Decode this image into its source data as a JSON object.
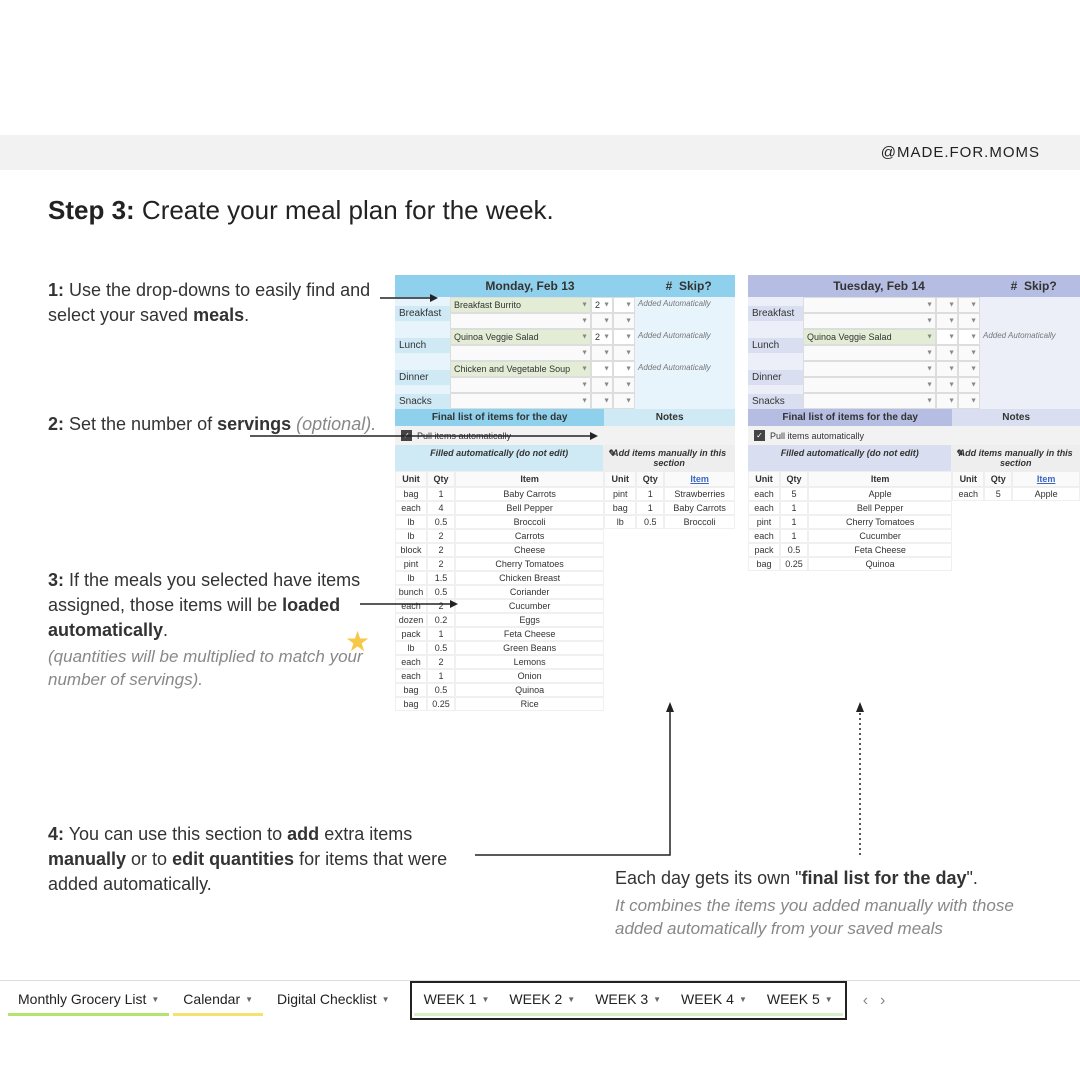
{
  "brand": "@MADE.FOR.MOMS",
  "heading_bold": "Step 3:",
  "heading_rest": " Create your meal plan for the week.",
  "ins1_n": "1:",
  "ins1": " Use the drop-downs to easily find and select your saved ",
  "ins1_b": "meals",
  "ins1_end": ".",
  "ins2_n": "2:",
  "ins2": " Set the number of ",
  "ins2_b": "servings",
  "ins2_it": " (optional).",
  "ins3_n": "3:",
  "ins3": " If the meals you selected have items assigned, those items will be ",
  "ins3_b": "loaded automatically",
  "ins3_end": ".",
  "ins3_sub": "(quantities will be multiplied to match your number of servings).",
  "ins4_n": "4:",
  "ins4_a": " You can use this section to ",
  "ins4_b1": "add",
  "ins4_b": " extra items ",
  "ins4_b2": "manually",
  "ins4_c": " or to ",
  "ins4_b3": "edit quantities",
  "ins4_d": " for items that were added automatically.",
  "insday_a": "Each day gets its own \"",
  "insday_b": "final list for the day",
  "insday_c": "\".",
  "insday_sub": "It combines the items you added manually with those added automatically from your saved meals",
  "hash": "#",
  "skip": "Skip?",
  "added_auto": "Added Automatically",
  "final_label": "Final list of items for the day",
  "notes_label": "Notes",
  "pull_label": "Pull items automatically",
  "sub_auto": "Filled automatically (do not edit)",
  "sub_manual": "Add items manually in this section",
  "col_unit": "Unit",
  "col_qty": "Qty",
  "col_item": "Item",
  "pencil": "✎",
  "meal_labels": {
    "bf": "Breakfast",
    "lu": "Lunch",
    "di": "Dinner",
    "sn": "Snacks"
  },
  "mon": {
    "title": "Monday, Feb 13",
    "bf": "Breakfast Burrito",
    "bf_q": "2",
    "lu": "Quinoa Veggie Salad",
    "lu_q": "2",
    "di": "Chicken and Vegetable Soup",
    "auto_items": [
      {
        "u": "bag",
        "q": "1",
        "i": "Baby Carrots"
      },
      {
        "u": "each",
        "q": "4",
        "i": "Bell Pepper"
      },
      {
        "u": "lb",
        "q": "0.5",
        "i": "Broccoli"
      },
      {
        "u": "lb",
        "q": "2",
        "i": "Carrots"
      },
      {
        "u": "block",
        "q": "2",
        "i": "Cheese"
      },
      {
        "u": "pint",
        "q": "2",
        "i": "Cherry Tomatoes"
      },
      {
        "u": "lb",
        "q": "1.5",
        "i": "Chicken Breast"
      },
      {
        "u": "bunch",
        "q": "0.5",
        "i": "Coriander"
      },
      {
        "u": "each",
        "q": "2",
        "i": "Cucumber"
      },
      {
        "u": "dozen",
        "q": "0.2",
        "i": "Eggs"
      },
      {
        "u": "pack",
        "q": "1",
        "i": "Feta Cheese"
      },
      {
        "u": "lb",
        "q": "0.5",
        "i": "Green Beans"
      },
      {
        "u": "each",
        "q": "2",
        "i": "Lemons"
      },
      {
        "u": "each",
        "q": "1",
        "i": "Onion"
      },
      {
        "u": "bag",
        "q": "0.5",
        "i": "Quinoa"
      },
      {
        "u": "bag",
        "q": "0.25",
        "i": "Rice"
      }
    ],
    "manual_items": [
      {
        "u": "pint",
        "q": "1",
        "i": "Strawberries"
      },
      {
        "u": "bag",
        "q": "1",
        "i": "Baby Carrots"
      },
      {
        "u": "lb",
        "q": "0.5",
        "i": "Broccoli"
      }
    ]
  },
  "tue": {
    "title": "Tuesday, Feb 14",
    "lu": "Quinoa Veggie Salad",
    "auto_items": [
      {
        "u": "each",
        "q": "5",
        "i": "Apple"
      },
      {
        "u": "each",
        "q": "1",
        "i": "Bell Pepper"
      },
      {
        "u": "pint",
        "q": "1",
        "i": "Cherry Tomatoes"
      },
      {
        "u": "each",
        "q": "1",
        "i": "Cucumber"
      },
      {
        "u": "pack",
        "q": "0.5",
        "i": "Feta Cheese"
      },
      {
        "u": "bag",
        "q": "0.25",
        "i": "Quinoa"
      }
    ],
    "manual_items": [
      {
        "u": "each",
        "q": "5",
        "i": "Apple"
      }
    ]
  },
  "tabs": {
    "grocery": "Monthly Grocery List",
    "calendar": "Calendar",
    "checklist": "Digital Checklist",
    "w1": "WEEK 1",
    "w2": "WEEK 2",
    "w3": "WEEK 3",
    "w4": "WEEK 4",
    "w5": "WEEK 5"
  }
}
